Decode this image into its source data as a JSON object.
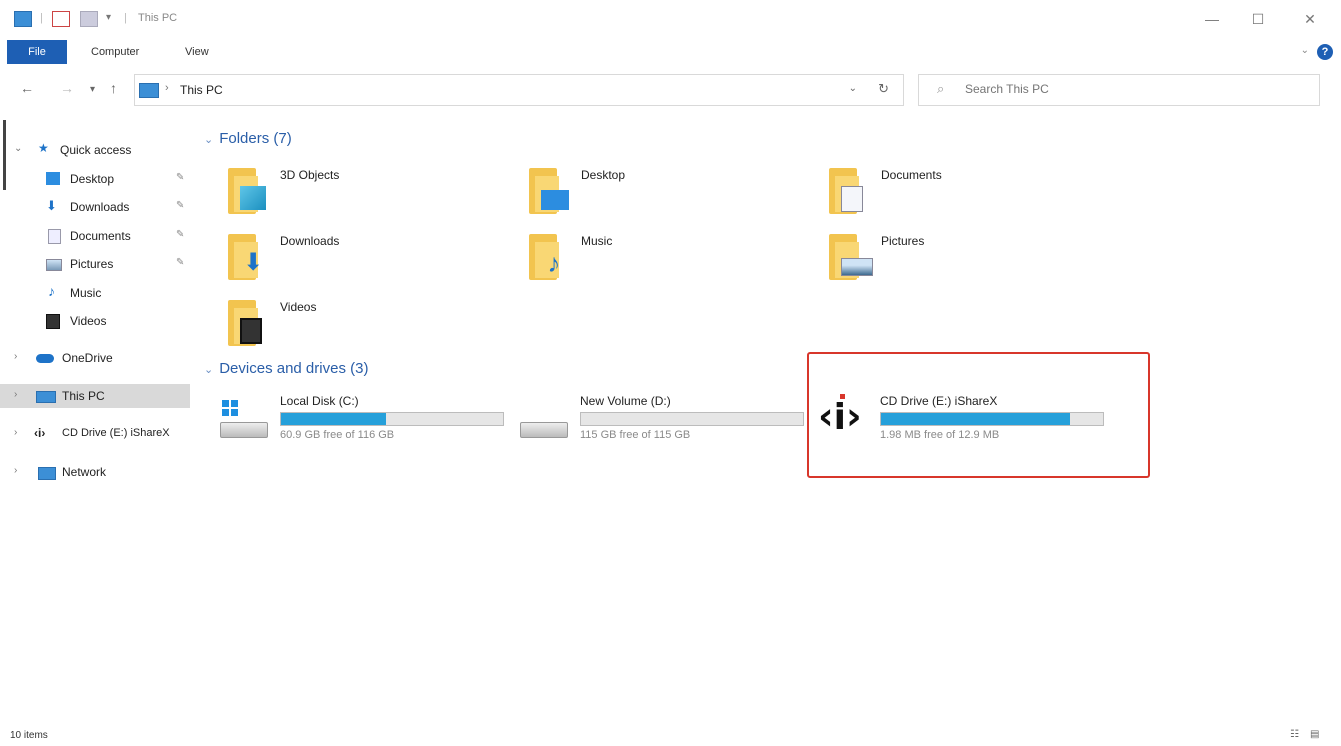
{
  "window": {
    "title": "This PC",
    "controls": {
      "minimize": "—",
      "maximize": "☐",
      "close": "✕"
    }
  },
  "ribbon": {
    "tabs": [
      "File",
      "Computer",
      "View"
    ],
    "help": "?"
  },
  "address": {
    "crumb": "This PC",
    "search_placeholder": "Search This PC"
  },
  "sidebar": {
    "quick_access": "Quick access",
    "items": [
      {
        "label": "Desktop",
        "icon": "desktop-icon"
      },
      {
        "label": "Downloads",
        "icon": "download-icon"
      },
      {
        "label": "Documents",
        "icon": "documents-icon"
      },
      {
        "label": "Pictures",
        "icon": "pictures-icon"
      },
      {
        "label": "Music",
        "icon": "music-icon"
      },
      {
        "label": "Videos",
        "icon": "videos-icon"
      }
    ],
    "onedrive": "OneDrive",
    "this_pc": "This PC",
    "cd_drive": "CD Drive (E:) iShareX",
    "network": "Network"
  },
  "main": {
    "folders_header": "Folders (7)",
    "folders": [
      "3D Objects",
      "Desktop",
      "Documents",
      "Downloads",
      "Music",
      "Pictures",
      "Videos"
    ],
    "drives_header": "Devices and drives (3)",
    "drives": [
      {
        "name": "Local Disk (C:)",
        "free": "60.9 GB free of 116 GB",
        "used_fraction": 0.475
      },
      {
        "name": "New Volume (D:)",
        "free": "115 GB free of 115 GB",
        "used_fraction": 0.0
      },
      {
        "name": "CD Drive (E:) iShareX",
        "free": "1.98 MB free of 12.9 MB",
        "used_fraction": 0.85
      }
    ]
  },
  "status": {
    "items": "10 items"
  },
  "colors": {
    "accent": "#1e5fb4",
    "progress": "#26a0da",
    "highlight_box": "#d8362b"
  }
}
